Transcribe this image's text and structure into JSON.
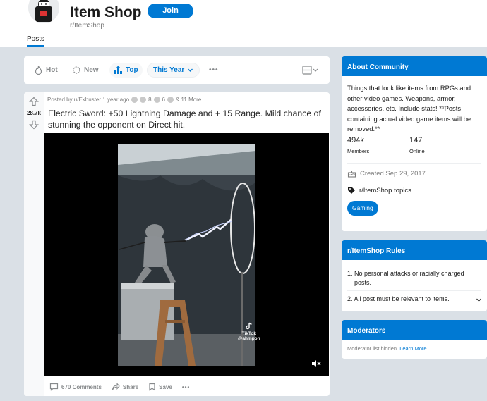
{
  "header": {
    "title": "Item Shop",
    "subreddit": "r/ItemShop",
    "join_label": "Join",
    "tab_posts": "Posts"
  },
  "sort": {
    "hot": "Hot",
    "new": "New",
    "top": "Top",
    "timeframe": "This Year",
    "more": "•••"
  },
  "post": {
    "score": "28.7k",
    "meta_prefix": "Posted by u/Ekbuster 1 year ago",
    "award_count_1": "8",
    "award_count_2": "6",
    "award_more": "& 11 More",
    "title": "Electric Sword: +50 Lightning Damage and + 15 Range. Mild chance of stunning the opponent on Direct hit.",
    "watermark": "TikTok",
    "watermark_handle": "@ahmpon",
    "comments": "670 Comments",
    "share": "Share",
    "save": "Save",
    "more": "•••"
  },
  "about": {
    "heading": "About Community",
    "description": "Things that look like items from RPGs and other video games. Weapons, armor, accessories, etc. Include stats! **Posts containing actual video game items will be removed.**",
    "members_value": "494k",
    "members_label": "Members",
    "online_value": "147",
    "online_label": "Online",
    "created": "Created Sep 29, 2017",
    "topics": "r/ItemShop topics",
    "tag": "Gaming"
  },
  "rules": {
    "heading": "r/ItemShop Rules",
    "items": [
      "1. No personal attacks or racially charged posts.",
      "2. All post must be relevant to items."
    ]
  },
  "moderators": {
    "heading": "Moderators",
    "hidden_text": "Moderator list hidden.",
    "learn_more": "Learn More"
  },
  "colors": {
    "accent": "#0079d3",
    "background": "#dae0e6"
  }
}
